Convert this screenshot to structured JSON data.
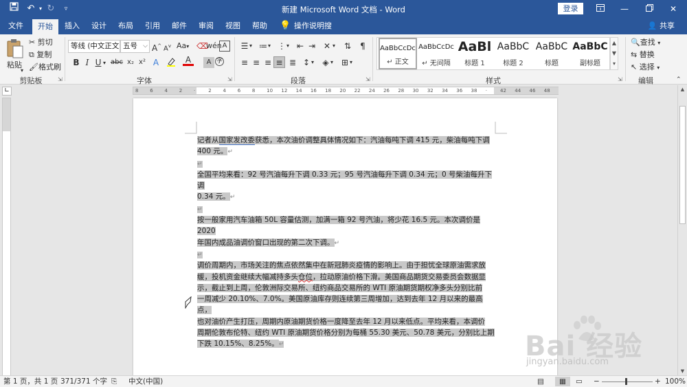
{
  "window": {
    "title": "新建 Microsoft Word 文档 - Word",
    "login_label": "登录"
  },
  "tabs": [
    {
      "label": "文件"
    },
    {
      "label": "开始"
    },
    {
      "label": "插入"
    },
    {
      "label": "设计"
    },
    {
      "label": "布局"
    },
    {
      "label": "引用"
    },
    {
      "label": "邮件"
    },
    {
      "label": "审阅"
    },
    {
      "label": "视图"
    },
    {
      "label": "帮助"
    },
    {
      "label": "操作说明搜索"
    }
  ],
  "share_label": "共享",
  "ribbon": {
    "clipboard": {
      "paste": "粘贴",
      "cut": "剪切",
      "copy": "复制",
      "format_painter": "格式刷",
      "label": "剪贴板"
    },
    "font": {
      "font_name": "等线 (中文正文",
      "font_size": "五号",
      "grow": "A",
      "shrink": "A",
      "case": "Aa",
      "bold": "B",
      "italic": "I",
      "underline": "U",
      "strike": "abc",
      "subscript": "x₂",
      "superscript": "x²",
      "label": "字体"
    },
    "paragraph": {
      "label": "段落"
    },
    "styles": {
      "items": [
        {
          "sample": "AaBbCcDc",
          "name": "↵ 正文"
        },
        {
          "sample": "AaBbCcDc",
          "name": "↵ 无间隔"
        },
        {
          "sample": "AaBl",
          "name": "标题 1"
        },
        {
          "sample": "AaBbC",
          "name": "标题 2"
        },
        {
          "sample": "AaBbC",
          "name": "标题"
        },
        {
          "sample": "AaBbC",
          "name": "副标题"
        }
      ],
      "label": "样式"
    },
    "editing": {
      "find": "查找",
      "replace": "替换",
      "select": "选择",
      "label": "编辑"
    }
  },
  "ruler": {
    "labels": [
      "8",
      "6",
      "4",
      "2",
      "",
      "2",
      "4",
      "6",
      "8",
      "10",
      "12",
      "14",
      "16",
      "18",
      "20",
      "22",
      "24",
      "26",
      "28",
      "30",
      "32",
      "34",
      "36",
      "38",
      "",
      "42",
      "44",
      "46",
      "48"
    ]
  },
  "document": {
    "paragraphs": [
      {
        "lines": [
          "记者从国家发改委获悉，本次油价调整具体情况如下：汽油每吨下调 415 元，柴油每吨下调",
          "400 元。"
        ]
      },
      {
        "lines": [
          "全国平均来看：92 号汽油每升下调 0.33 元；95 号汽油每升下调 0.34 元；0 号柴油每升下调",
          "0.34 元。"
        ]
      },
      {
        "lines": [
          "按一般家用汽车油箱 50L 容量估测，加满一箱 92 号汽油，将少花 16.5 元。本次调价是 2020",
          "年国内成品油调价窗口出现的第二次下调。"
        ]
      },
      {
        "lines": [
          "调价周期内，市场关注的焦点依然集中在新冠肺炎疫情的影响上。由于担忧全球原油需求放",
          "缓，投机资金继续大幅减持多头仓位，拉动原油价格下滑。美国商品期货交易委员会数据显",
          "示，截止到上周，伦敦洲际交易所、纽约商品交易所的 WTI 原油期货期权净多头分别比前",
          "一周减少 20.10%、7.0%。美国原油库存则连续第三周增加，达到去年 12 月以来的最高点，",
          "也对油价产生打压，周期内原油期货价格一度降至去年 12 月以来低点。平均来看，本调价",
          "周期伦敦布伦特、纽约 WTI 原油期货价格分别为每桶 55.30 美元、50.78 美元，分别比上期",
          "下跌 10.15%、8.25%。"
        ]
      }
    ],
    "paragraph_mark": "↵"
  },
  "status": {
    "page_info": "第 1 页，共 1 页",
    "word_count": "371/371 个字",
    "language": "中文(中国)",
    "zoom_level": "100%"
  },
  "watermark": {
    "text": "Bai 经验",
    "url": "jingyan.baidu.com"
  },
  "colors": {
    "brand": "#2b579a",
    "selection": "#c8c8c8"
  }
}
